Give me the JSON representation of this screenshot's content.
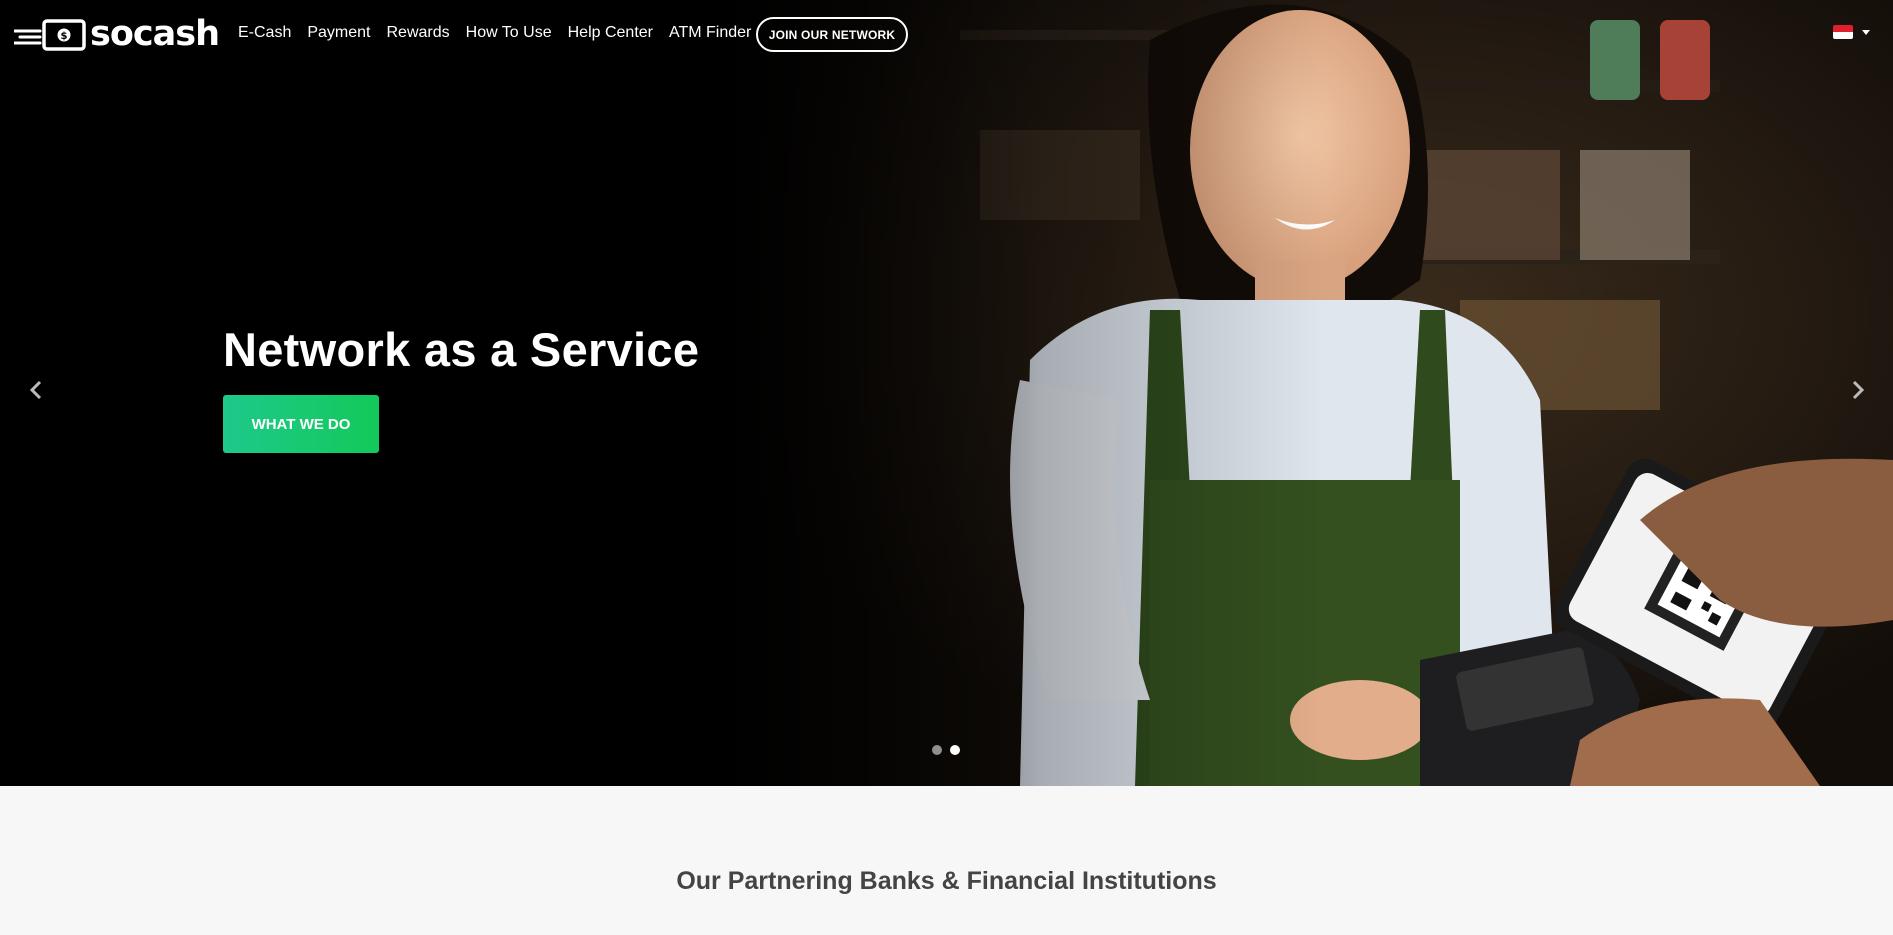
{
  "brand": {
    "name": "socash",
    "logo_icon": "cash-note-icon"
  },
  "nav": {
    "links": [
      {
        "label": "E-Cash"
      },
      {
        "label": "Payment"
      },
      {
        "label": "Rewards"
      },
      {
        "label": "How To Use"
      },
      {
        "label": "Help Center"
      },
      {
        "label": "ATM Finder"
      }
    ],
    "join_label": "JOIN OUR NETWORK",
    "language_flag": "singapore-flag-icon"
  },
  "hero": {
    "title": "Network as a Service",
    "cta_label": "WHAT WE DO",
    "slide_count": 2,
    "active_slide": 2
  },
  "partners": {
    "title": "Our Partnering Banks & Financial Institutions"
  },
  "colors": {
    "accent_green_start": "#1ec98a",
    "accent_green_end": "#13c95a",
    "hero_bg": "#000000",
    "section_bg": "#f7f7f7",
    "heading_text": "#444444"
  }
}
